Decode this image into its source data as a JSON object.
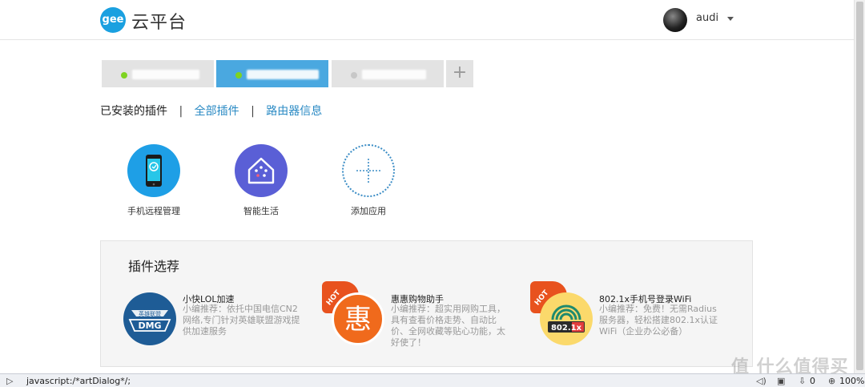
{
  "header": {
    "logo_mark": "gee",
    "logo_text": "云平台",
    "username": "audi"
  },
  "router_tabs": [
    {
      "status": "online",
      "active": false
    },
    {
      "status": "online",
      "active": true
    },
    {
      "status": "offline",
      "active": false
    }
  ],
  "add_router_label": "+",
  "subnav": {
    "current": "已安装的插件",
    "separator": "|",
    "links": [
      "全部插件",
      "路由器信息"
    ]
  },
  "installed_apps": [
    {
      "label": "手机远程管理",
      "icon": "phone-remote-icon"
    },
    {
      "label": "智能生活",
      "icon": "smart-home-icon"
    },
    {
      "label": "添加应用",
      "icon": "add-app-icon"
    }
  ],
  "plugin_picks": {
    "title": "插件选荐",
    "items": [
      {
        "name": "小快LOL加速",
        "desc": "小编推荐：依托中国电信CN2网络,专门针对英雄联盟游戏提供加速服务",
        "icon": "lol-accelerator-icon",
        "icon_text": "英雄联盟",
        "icon_text2": "DMG",
        "hot": false
      },
      {
        "name": "惠惠购物助手",
        "desc": "小编推荐：超实用网购工具，具有查看价格走势、自动比价、全网收藏等贴心功能，太好使了！",
        "icon": "huihui-shopping-icon",
        "icon_text": "惠",
        "hot": true,
        "hot_label": "HOT"
      },
      {
        "name": "802.1x手机号登录WiFi",
        "desc": "小编推荐：免费！无需Radius服务器，轻松搭建802.1x认证WiFi（企业办公必备）",
        "icon": "wifi-8021x-icon",
        "icon_text": "802.1x",
        "hot": true,
        "hot_label": "HOT"
      }
    ]
  },
  "statusbar": {
    "url": "javascript:/*artDialog*/;",
    "count": "0",
    "zoom": "100%"
  },
  "watermark": "值 什么值得买",
  "colors": {
    "accent": "#4aa8e0",
    "link": "#2a8ac4",
    "online_dot": "#7ed321",
    "hot": "#e8521e"
  }
}
